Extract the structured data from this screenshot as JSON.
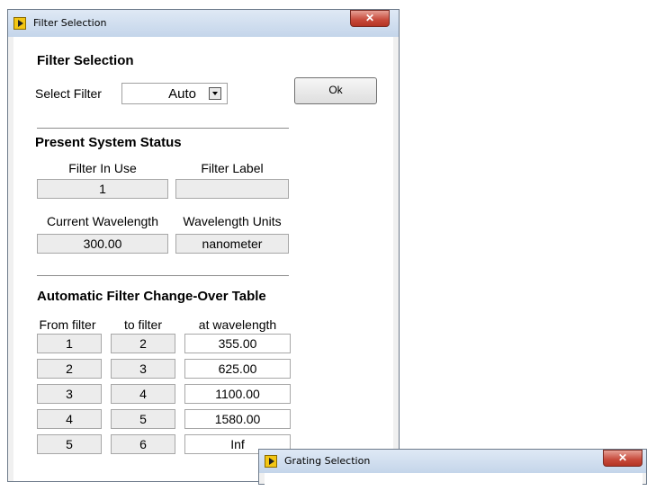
{
  "filter_window": {
    "title": "Filter Selection",
    "section_filter": "Filter Selection",
    "select_label": "Select Filter",
    "select_value": "Auto",
    "ok_label": "Ok",
    "section_status": "Present System Status",
    "filter_in_use_label": "Filter In Use",
    "filter_in_use_value": "1",
    "filter_label_label": "Filter Label",
    "filter_label_value": "",
    "current_wavelength_label": "Current Wavelength",
    "current_wavelength_value": "300.00",
    "wavelength_units_label": "Wavelength Units",
    "wavelength_units_value": "nanometer",
    "section_table": "Automatic Filter Change-Over Table",
    "col_from": "From filter",
    "col_to": "to filter",
    "col_at": "at wavelength",
    "rows": [
      {
        "from": "1",
        "to": "2",
        "at": "355.00"
      },
      {
        "from": "2",
        "to": "3",
        "at": "625.00"
      },
      {
        "from": "3",
        "to": "4",
        "at": "1100.00"
      },
      {
        "from": "4",
        "to": "5",
        "at": "1580.00"
      },
      {
        "from": "5",
        "to": "6",
        "at": "Inf"
      }
    ]
  },
  "grating_window": {
    "title": "Grating Selection"
  },
  "colors": {
    "titlebar": "#c4d5ea",
    "close_button": "#c7493a",
    "field_background": "#ececec",
    "window_background": "#ffffff"
  },
  "icons": [
    "labview-app-icon",
    "close-icon",
    "dropdown-arrow-icon"
  ]
}
